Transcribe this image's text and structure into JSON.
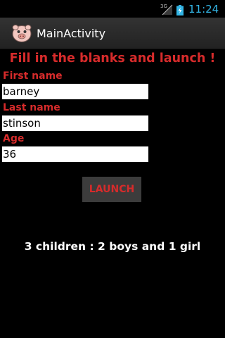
{
  "status_bar": {
    "network_type": "3G",
    "signal_icon": "signal-icon",
    "battery_icon": "battery-charging-icon",
    "time": "11:24",
    "time_color": "#33b5e5"
  },
  "action_bar": {
    "title": "MainActivity",
    "icon": "app-launcher-icon"
  },
  "form": {
    "heading": "Fill in the blanks and launch !",
    "accent_color": "#d62b2b",
    "fields": [
      {
        "label": "First name",
        "value": "barney"
      },
      {
        "label": "Last name",
        "value": "stinson"
      },
      {
        "label": "Age",
        "value": "36"
      }
    ],
    "launch_label": "LAUNCH"
  },
  "result": {
    "text": "3 children : 2 boys and 1 girl"
  }
}
